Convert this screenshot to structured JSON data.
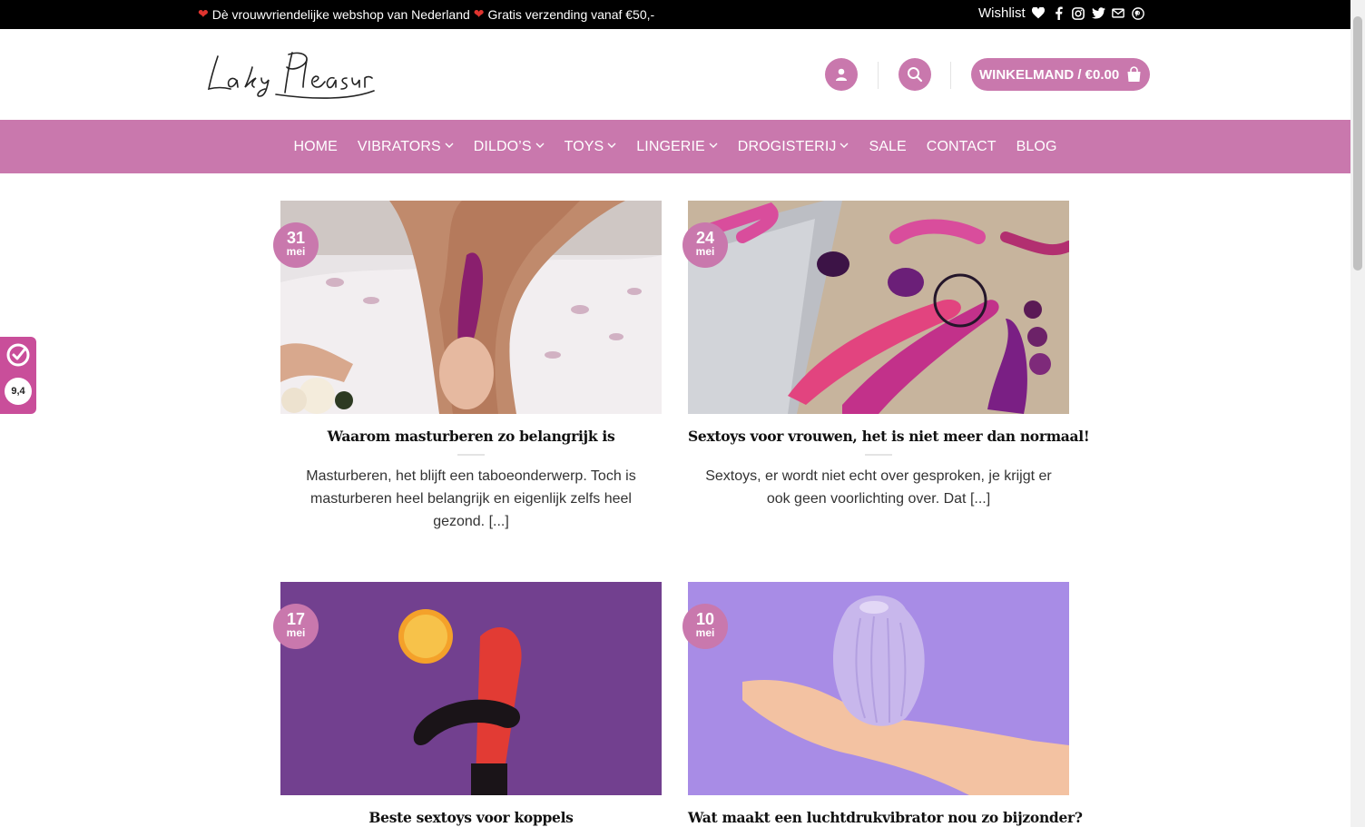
{
  "topbar": {
    "message_1": "Dè vrouwvriendelijke webshop van Nederland",
    "message_2": "Gratis verzending vanaf €50,-",
    "wishlist": "Wishlist"
  },
  "header": {
    "logo_text": "Lady Pleasure",
    "cart_label": "WINKELMAND / €0.00"
  },
  "nav": {
    "items": [
      {
        "label": "HOME",
        "has_dropdown": false
      },
      {
        "label": "VIBRATORS",
        "has_dropdown": true
      },
      {
        "label": "DILDO’S",
        "has_dropdown": true
      },
      {
        "label": "TOYS",
        "has_dropdown": true
      },
      {
        "label": "LINGERIE",
        "has_dropdown": true
      },
      {
        "label": "DROGISTERIJ",
        "has_dropdown": true
      },
      {
        "label": "SALE",
        "has_dropdown": false
      },
      {
        "label": "CONTACT",
        "has_dropdown": false
      },
      {
        "label": "BLOG",
        "has_dropdown": false
      }
    ]
  },
  "posts": [
    {
      "day": "31",
      "month": "mei",
      "title": "Waarom masturberen zo belangrijk is",
      "excerpt": "Masturberen, het blijft een taboeonderwerp. Toch is masturberen heel belangrijk en eigenlijk zelfs heel gezond. [...]"
    },
    {
      "day": "24",
      "month": "mei",
      "title": "Sextoys voor vrouwen, het is niet meer dan normaal!",
      "excerpt": "Sextoys, er wordt niet echt over gesproken, je krijgt er ook geen voorlichting over. Dat [...]"
    },
    {
      "day": "17",
      "month": "mei",
      "title": "Beste sextoys voor koppels",
      "excerpt": ""
    },
    {
      "day": "10",
      "month": "mei",
      "title": "Wat maakt een luchtdrukvibrator nou zo bijzonder?",
      "excerpt": ""
    }
  ],
  "widget": {
    "rating": "9,4"
  },
  "colors": {
    "brand_pink": "#c978ad",
    "topbar_bg": "#000000",
    "heart_red": "#e0342f",
    "widget_pink": "#c94e9a"
  },
  "icons": [
    "heart-icon",
    "facebook-icon",
    "instagram-icon",
    "twitter-icon",
    "envelope-icon",
    "pinterest-icon",
    "user-icon",
    "search-icon",
    "shopping-bag-icon",
    "chevron-down-icon",
    "checkmark-seal-icon"
  ]
}
